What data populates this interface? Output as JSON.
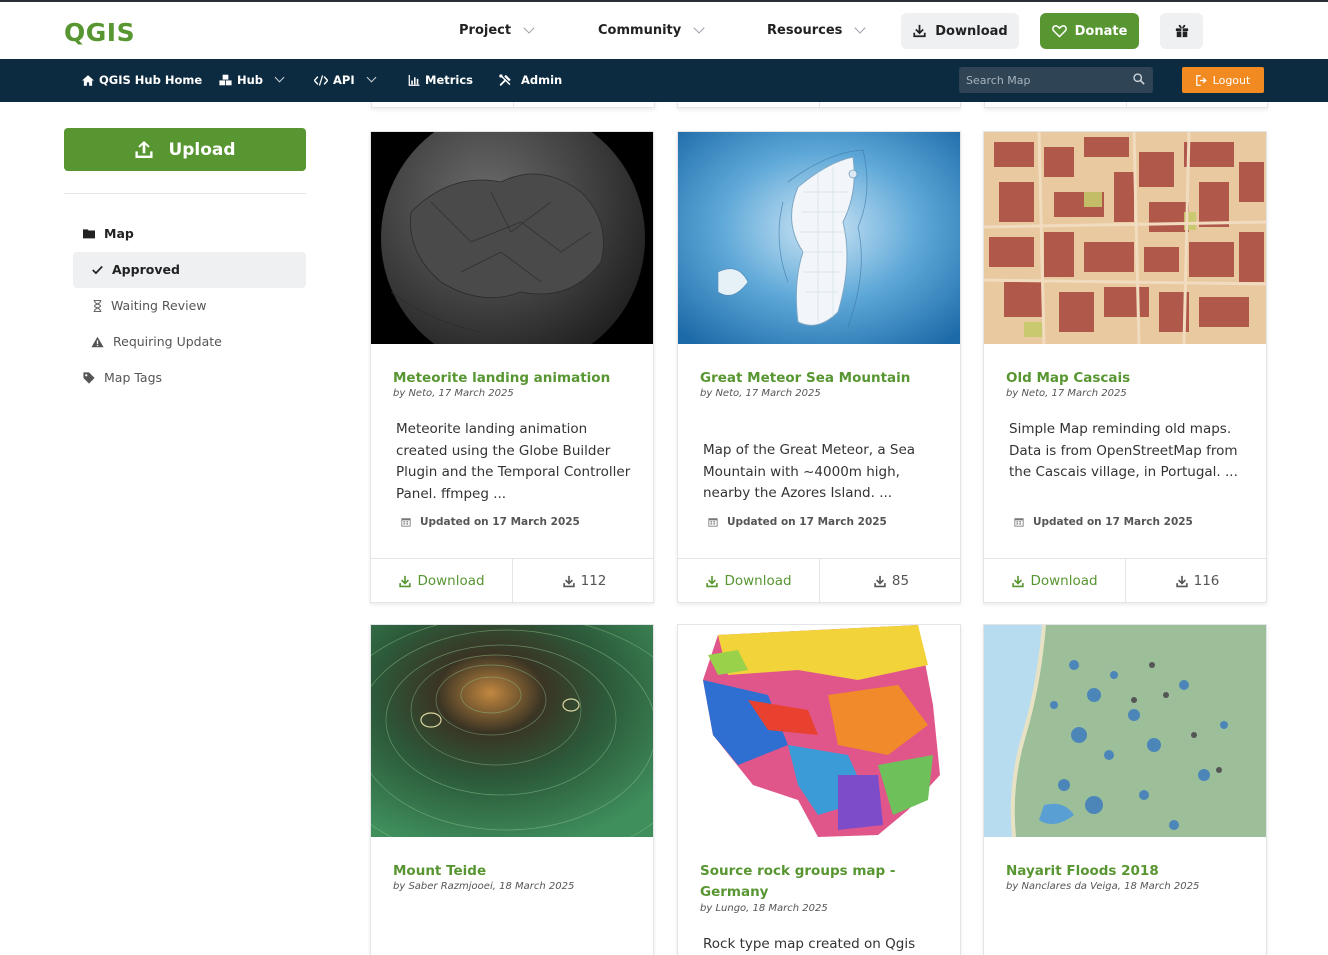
{
  "brand": {
    "logo": "QGIS"
  },
  "topnav": {
    "items": [
      "Project",
      "Community",
      "Resources"
    ],
    "download_label": "Download",
    "donate_label": "Donate"
  },
  "hubnav": {
    "home": "QGIS Hub Home",
    "hub": "Hub",
    "api": "API",
    "metrics": "Metrics",
    "admin": "Admin",
    "search_placeholder": "Search Map",
    "logout": "Logout"
  },
  "sidebar": {
    "upload_label": "Upload",
    "section": "Map",
    "items": [
      {
        "label": "Approved",
        "icon": "check-icon",
        "active": true
      },
      {
        "label": "Waiting Review",
        "icon": "hourglass-icon"
      },
      {
        "label": "Requiring Update",
        "icon": "warning-icon"
      }
    ],
    "tags_label": "Map Tags"
  },
  "cards": [
    {
      "title": "Meteorite landing animation",
      "byline": "by Neto, 17 March 2025",
      "description": "Meteorite landing animation created using the Globe Builder Plugin and the Temporal Controller Panel. ffmpeg ...",
      "updated": "Updated on 17 March 2025",
      "download_label": "Download",
      "downloads": "112"
    },
    {
      "title": "Great Meteor Sea Mountain",
      "byline": "by Neto, 17 March 2025",
      "description": "Map of the Great Meteor, a Sea Mountain with ~4000m high, nearby the Azores Island. ...",
      "updated": "Updated on 17 March 2025",
      "download_label": "Download",
      "downloads": "85"
    },
    {
      "title": "Old Map Cascais",
      "byline": "by Neto, 17 March 2025",
      "description": "Simple Map reminding old maps. Data is from OpenStreetMap from the Cascais village, in Portugal. ...",
      "updated": "Updated on 17 March 2025",
      "download_label": "Download",
      "downloads": "116"
    },
    {
      "title": "Mount Teide",
      "byline": "by Saber Razmjooei, 18 March 2025"
    },
    {
      "title": "Source rock groups map - Germany",
      "byline": "by Lungo, 18 March 2025",
      "description": "Rock type map created on Qgis"
    },
    {
      "title": "Nayarit Floods 2018",
      "byline": "by Nanclares da Veiga, 18 March 2025"
    }
  ],
  "colors": {
    "brand_green": "#589632",
    "nav_dark": "#0d2b40",
    "logout_orange": "#f28a22"
  }
}
